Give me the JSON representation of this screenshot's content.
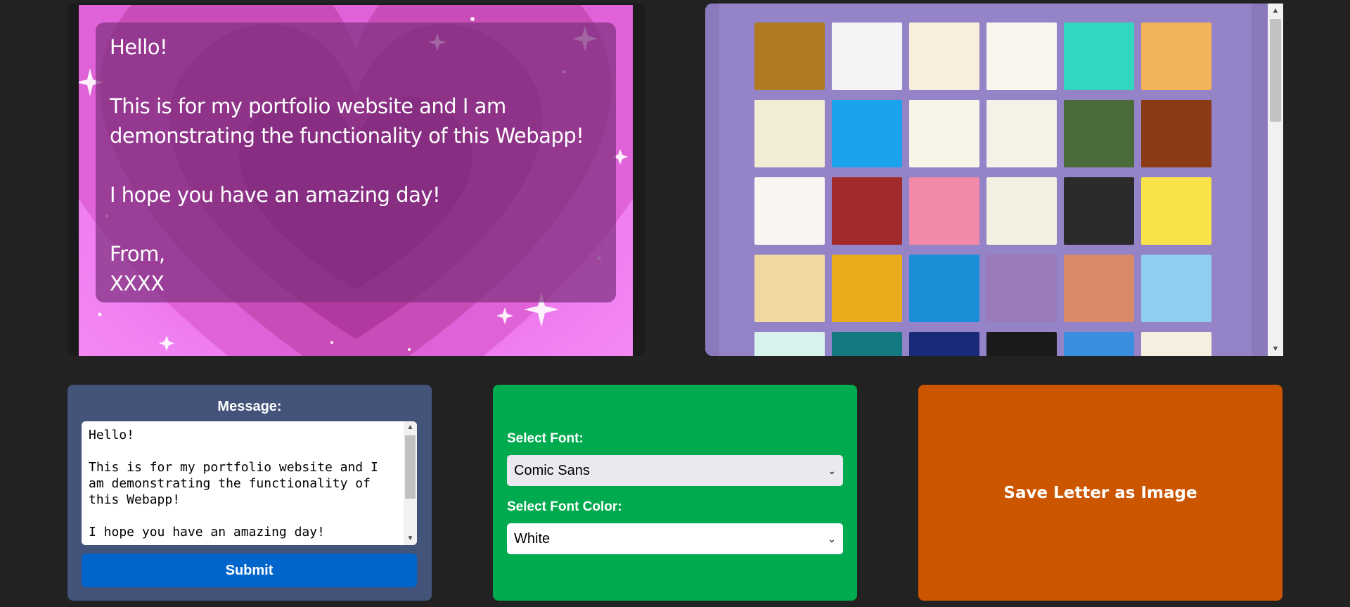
{
  "letter": {
    "text": "Hello!\n\nThis is for my portfolio website and I am\ndemonstrating the functionality of this Webapp!\n\nI hope you have an amazing day!\n\nFrom,\nXXXX"
  },
  "background_picker": {
    "tiles": [
      {
        "name": "autumn-leaves-tile",
        "color": "#b07a22"
      },
      {
        "name": "airmail-tile",
        "color": "#f4f4f4"
      },
      {
        "name": "cream-border-tile",
        "color": "#f7efdc"
      },
      {
        "name": "balloons-tile",
        "color": "#f8f6ee"
      },
      {
        "name": "teal-blob-tile",
        "color": "#33d6bf"
      },
      {
        "name": "orange-wave-tile",
        "color": "#f2b35a"
      },
      {
        "name": "spring-flowers-tile",
        "color": "#f3ecd4"
      },
      {
        "name": "blue-sky-plane-tile",
        "color": "#1aa3ec"
      },
      {
        "name": "bunting-eggs-tile",
        "color": "#f7f5e8"
      },
      {
        "name": "navy-wave-tile",
        "color": "#f4f1e6"
      },
      {
        "name": "camo-tile",
        "color": "#4a6b3a"
      },
      {
        "name": "autumn-frame-tile",
        "color": "#8a3a15"
      },
      {
        "name": "petals-tile",
        "color": "#fbf5f2"
      },
      {
        "name": "chocolates-tile",
        "color": "#a12a2a"
      },
      {
        "name": "pink-ribbon-tile",
        "color": "#f08aa8"
      },
      {
        "name": "stitched-cream-tile",
        "color": "#f3f0e2"
      },
      {
        "name": "dark-check-tile",
        "color": "#2b2b2b"
      },
      {
        "name": "yellow-tile",
        "color": "#f9e24a"
      },
      {
        "name": "desert-mountain-tile",
        "color": "#f0d9a0"
      },
      {
        "name": "golden-frame-tile",
        "color": "#e8ac1c"
      },
      {
        "name": "blue-stripe-tile",
        "color": "#1a8ed6"
      },
      {
        "name": "purple-floral-tile",
        "color": "#9a7ab8"
      },
      {
        "name": "salmon-pattern-tile",
        "color": "#d98a6a"
      },
      {
        "name": "blue-clouds-tile",
        "color": "#8fd0f0"
      },
      {
        "name": "mint-leaves-tile",
        "color": "#d8f2ee"
      },
      {
        "name": "teal-tree-tile",
        "color": "#127a80"
      },
      {
        "name": "fireworks-tile",
        "color": "#1a2a7a"
      },
      {
        "name": "black-tile",
        "color": "#1a1a1a"
      },
      {
        "name": "blue-frame-tile",
        "color": "#3a8ee0"
      },
      {
        "name": "plain-cream-tile",
        "color": "#f6efe0"
      }
    ]
  },
  "message_panel": {
    "label": "Message:",
    "text": "Hello!\n\nThis is for my portfolio website and I\nam demonstrating the functionality of\nthis Webapp!\n\nI hope you have an amazing day!",
    "submit_label": "Submit"
  },
  "font_panel": {
    "font_label": "Select Font:",
    "font_value": "Comic Sans",
    "color_label": "Select Font Color:",
    "color_value": "White"
  },
  "save_panel": {
    "label": "Save Letter as Image"
  },
  "colors": {
    "page_bg": "#232222",
    "message_panel": "#44537a",
    "font_panel": "#00aa4f",
    "save_panel": "#cc5500",
    "submit_button": "#0066cc",
    "picker_bg": "#9483c6"
  }
}
